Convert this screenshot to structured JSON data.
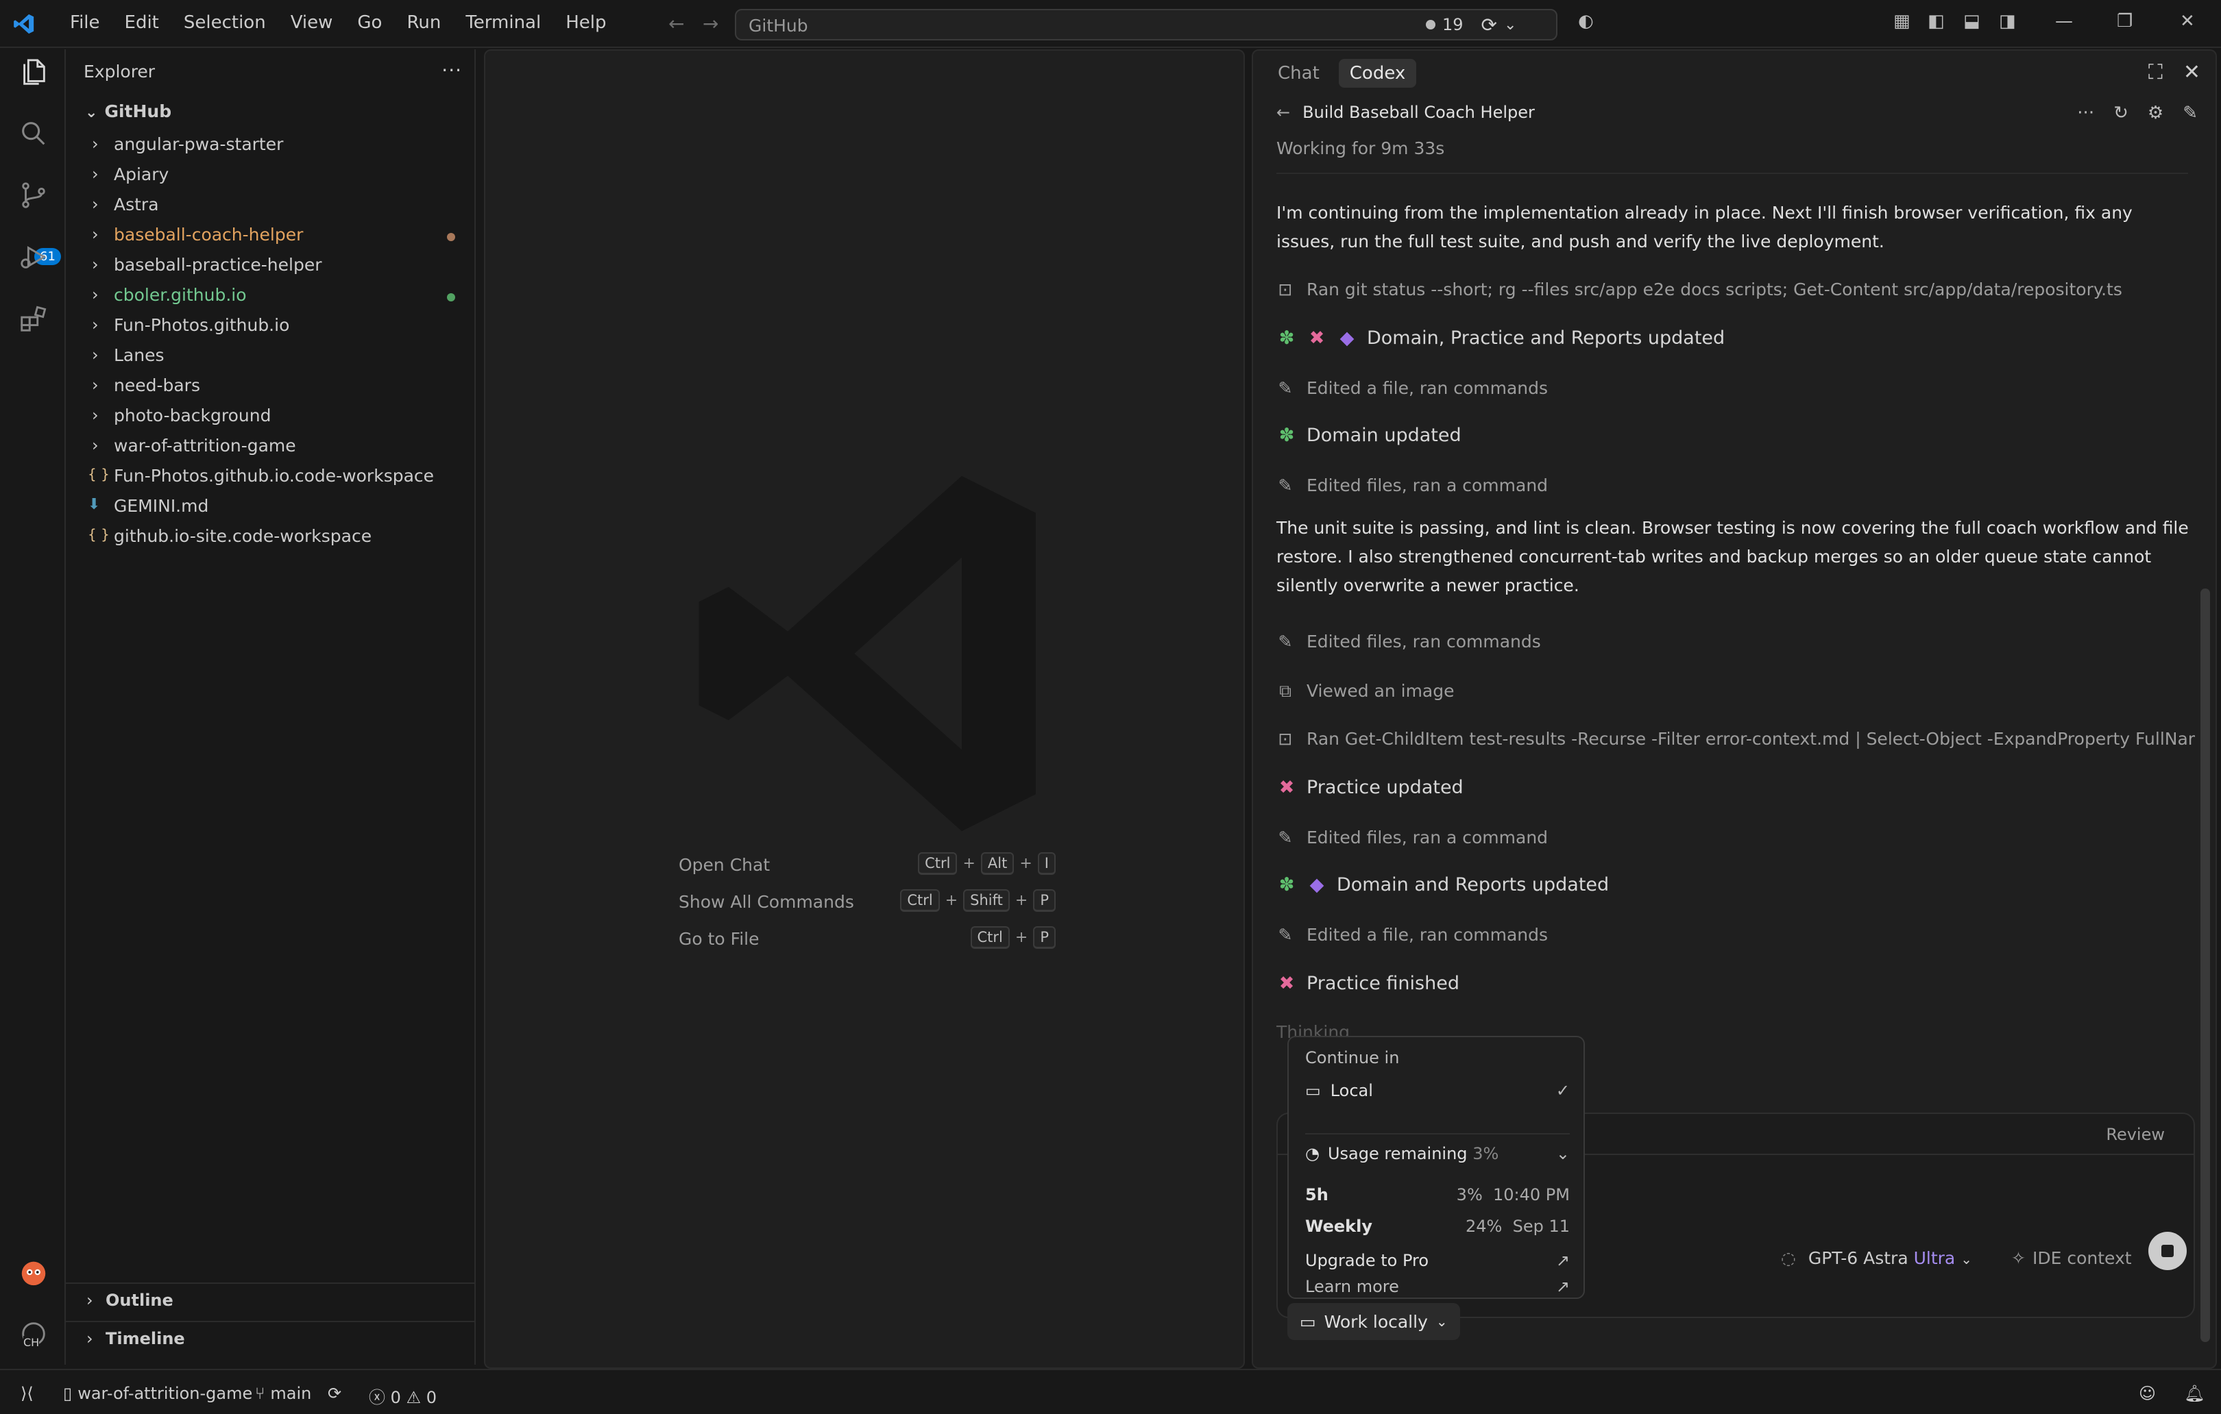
{
  "menu": [
    "File",
    "Edit",
    "Selection",
    "View",
    "Go",
    "Run",
    "Terminal",
    "Help"
  ],
  "command_center": "GitHub",
  "titlebar": {
    "notification_count": "19"
  },
  "activity": {
    "source_control_badge": "61",
    "account_initials": "CH"
  },
  "sidebar": {
    "title": "Explorer",
    "root": "GitHub",
    "items": [
      {
        "label": "angular-pwa-starter",
        "type": "folder"
      },
      {
        "label": "Apiary",
        "type": "folder"
      },
      {
        "label": "Astra",
        "type": "folder"
      },
      {
        "label": "baseball-coach-helper",
        "type": "folder",
        "color": "#e2a35f",
        "modified": "#a8785a"
      },
      {
        "label": "baseball-practice-helper",
        "type": "folder"
      },
      {
        "label": "cboler.github.io",
        "type": "folder",
        "color": "#73c991",
        "modified": "#52a262"
      },
      {
        "label": "Fun-Photos.github.io",
        "type": "folder"
      },
      {
        "label": "Lanes",
        "type": "folder"
      },
      {
        "label": "need-bars",
        "type": "folder"
      },
      {
        "label": "photo-background",
        "type": "folder"
      },
      {
        "label": "war-of-attrition-game",
        "type": "folder"
      },
      {
        "label": "Fun-Photos.github.io.code-workspace",
        "type": "workspace"
      },
      {
        "label": "GEMINI.md",
        "type": "markdown"
      },
      {
        "label": "github.io-site.code-workspace",
        "type": "workspace"
      }
    ],
    "outline": "Outline",
    "timeline": "Timeline"
  },
  "editor": {
    "shortcuts": [
      {
        "label": "Open Chat",
        "keys": [
          "Ctrl",
          "Alt",
          "I"
        ]
      },
      {
        "label": "Show All Commands",
        "keys": [
          "Ctrl",
          "Shift",
          "P"
        ]
      },
      {
        "label": "Go to File",
        "keys": [
          "Ctrl",
          "P"
        ]
      }
    ]
  },
  "codex": {
    "tabs": [
      "Chat",
      "Codex"
    ],
    "thread_title": "Build Baseball Coach Helper",
    "working": "Working for 9m 33s",
    "msg1": "I'm continuing from the implementation already in place. Next I'll finish browser verification, fix any issues, run the full test suite, and push and verify the live deployment.",
    "act_git": "Ran git status --short; rg --files src/app e2e docs scripts; Get-Content src/app/data/repository.ts",
    "upd1": "Domain, Practice and Reports updated",
    "act1": "Edited a file, ran commands",
    "upd2": "Domain updated",
    "act2": "Edited files, ran a command",
    "msg2": "The unit suite is passing, and lint is clean. Browser testing is now covering the full coach workflow and file restore. I also strengthened concurrent-tab writes and backup merges so an older queue state cannot silently overwrite a newer practice.",
    "act3": "Edited files, ran commands",
    "act4": "Viewed an image",
    "act5": "Ran Get-ChildItem test-results -Recurse -Filter error-context.md | Select-Object -ExpandProperty FullNam...",
    "upd3": "Practice updated",
    "act6": "Edited files, ran a command",
    "upd4": "Domain and Reports updated",
    "act7": "Edited a file, ran commands",
    "upd5": "Practice finished",
    "thinking": "Thinking",
    "review": "Review",
    "model": "GPT-6 Astra",
    "model_tier": "Ultra",
    "ide_context": "IDE context",
    "work_locally": "Work locally",
    "popup": {
      "continue_in": "Continue in",
      "local": "Local",
      "usage_label": "Usage remaining",
      "usage_pct": "3%",
      "h5_label": "5h",
      "h5_pct": "3%",
      "h5_time": "10:40 PM",
      "weekly_label": "Weekly",
      "weekly_pct": "24%",
      "weekly_date": "Sep 11",
      "upgrade": "Upgrade to Pro",
      "learn_more": "Learn more"
    }
  },
  "status": {
    "workspace": "war-of-attrition-game",
    "branch": "main",
    "errors": "0",
    "warnings": "0"
  }
}
